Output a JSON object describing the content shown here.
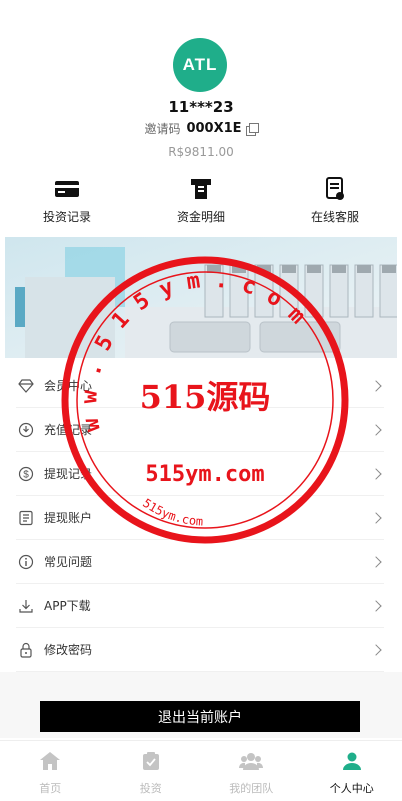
{
  "profile": {
    "avatar_text": "ATL",
    "username": "11***23",
    "invite_label": "邀请码",
    "invite_code": "000X1E",
    "balance": "R$9811.00"
  },
  "quick_actions": [
    {
      "label": "投资记录",
      "icon": "card-icon"
    },
    {
      "label": "资金明细",
      "icon": "receipt-printer-icon"
    },
    {
      "label": "在线客服",
      "icon": "document-service-icon"
    }
  ],
  "menu": [
    {
      "label": "会员中心",
      "icon": "diamond-icon"
    },
    {
      "label": "充值记录",
      "icon": "recharge-icon"
    },
    {
      "label": "提现记录",
      "icon": "dollar-coin-icon"
    },
    {
      "label": "提现账户",
      "icon": "account-list-icon"
    },
    {
      "label": "常见问题",
      "icon": "info-icon"
    },
    {
      "label": "APP下载",
      "icon": "download-icon"
    },
    {
      "label": "修改密码",
      "icon": "lock-icon"
    }
  ],
  "logout_label": "退出当前账户",
  "tabs": [
    {
      "label": "首页",
      "icon": "home-icon",
      "active": false
    },
    {
      "label": "投资",
      "icon": "clipboard-icon",
      "active": false
    },
    {
      "label": "我的团队",
      "icon": "team-icon",
      "active": false
    },
    {
      "label": "个人中心",
      "icon": "user-icon",
      "active": true
    }
  ],
  "watermark": {
    "ring_text": "w w . 5 1 5 y m . c o m",
    "title": "515源码",
    "domain": "515ym.com",
    "bottom_text": "515ym.com"
  },
  "colors": {
    "accent": "#1fae8a",
    "stamp_red": "#e8141b",
    "logout_bg": "#000000"
  }
}
